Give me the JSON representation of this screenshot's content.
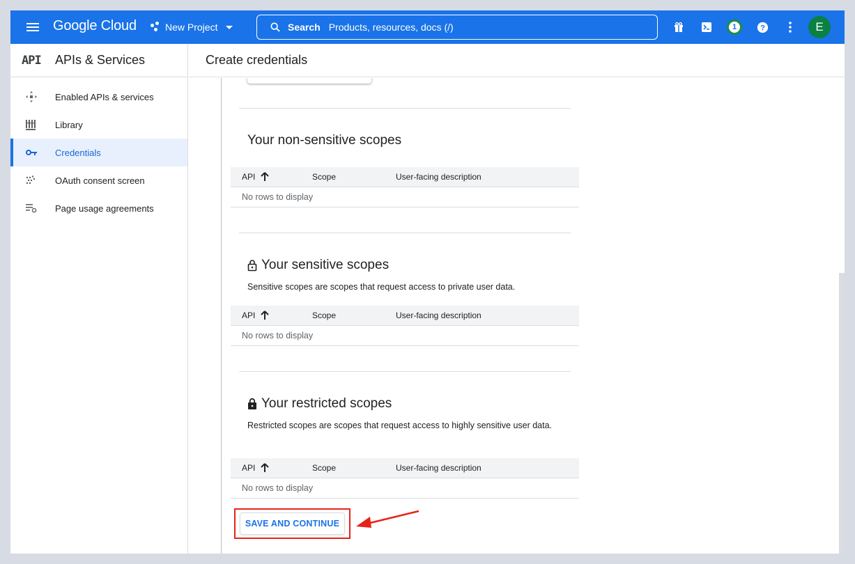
{
  "topbar": {
    "logo": "Google Cloud",
    "project": "New Project",
    "search_label": "Search",
    "search_placeholder": "Products, resources, docs (/)",
    "notification_count": "1",
    "avatar_letter": "E",
    "color": "#1a73e8"
  },
  "sidebar": {
    "api_logo": "API",
    "title": "APIs & Services",
    "items": [
      {
        "label": "Enabled APIs & services",
        "icon": "enabled-apis-icon"
      },
      {
        "label": "Library",
        "icon": "library-icon"
      },
      {
        "label": "Credentials",
        "icon": "key-icon",
        "active": true
      },
      {
        "label": "OAuth consent screen",
        "icon": "oauth-icon"
      },
      {
        "label": "Page usage agreements",
        "icon": "agreements-icon"
      }
    ]
  },
  "main": {
    "title": "Create credentials",
    "sections": [
      {
        "title": "Your non-sensitive scopes",
        "description": "",
        "columns": [
          "API",
          "Scope",
          "User-facing description"
        ],
        "empty_text": "No rows to display"
      },
      {
        "title": "Your sensitive scopes",
        "description": "Sensitive scopes are scopes that request access to private user data.",
        "columns": [
          "API",
          "Scope",
          "User-facing description"
        ],
        "empty_text": "No rows to display"
      },
      {
        "title": "Your restricted scopes",
        "description": "Restricted scopes are scopes that request access to highly sensitive user data.",
        "columns": [
          "API",
          "Scope",
          "User-facing description"
        ],
        "empty_text": "No rows to display"
      }
    ],
    "save_button": "SAVE AND CONTINUE"
  },
  "colors": {
    "accent": "#1a73e8",
    "highlight": "#e8221a"
  }
}
